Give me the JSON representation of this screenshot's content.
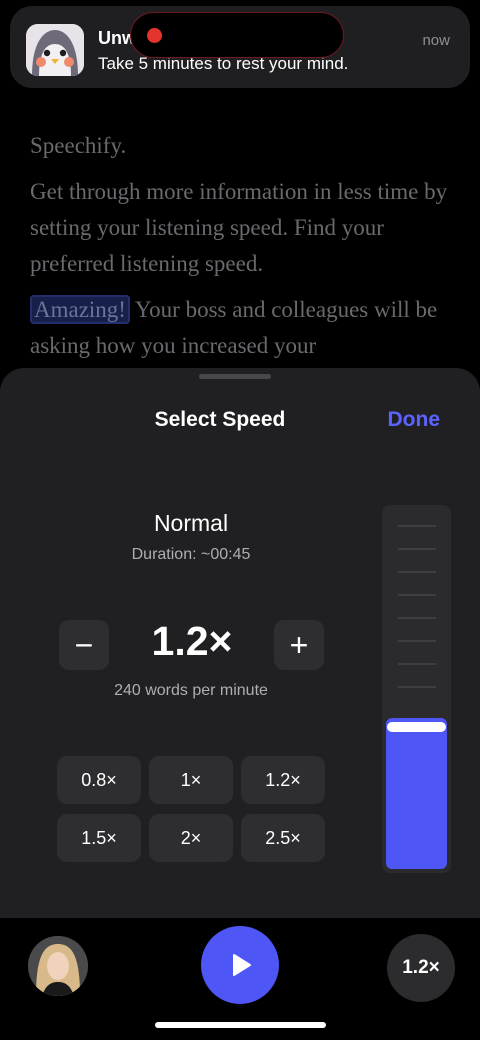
{
  "reader": {
    "line1": "Speechify.",
    "para2": "Get through more information in less time by setting your listening speed. Find your preferred listening speed.",
    "highlight": "Amazing!",
    "para3_rest": " Your boss and colleagues will be asking how you increased your"
  },
  "notification": {
    "app_name": "Unwi",
    "body": "Take 5 minutes to rest your mind.",
    "time": "now"
  },
  "sheet": {
    "title": "Select Speed",
    "done_label": "Done",
    "speed_name": "Normal",
    "duration": "Duration: ~00:45",
    "current_speed": "1.2×",
    "wpm": "240 words per minute",
    "minus_label": "−",
    "plus_label": "+",
    "presets": [
      "0.8×",
      "1×",
      "1.2×",
      "1.5×",
      "2×",
      "2.5×"
    ],
    "slider_level": 0.42
  },
  "player": {
    "speed_badge": "1.2×"
  },
  "colors": {
    "accent": "#4f56f6",
    "done": "#5b63ff",
    "record": "#e5342c"
  },
  "icons": [
    "app-icon",
    "record-dot-icon",
    "play-icon",
    "avatar"
  ]
}
